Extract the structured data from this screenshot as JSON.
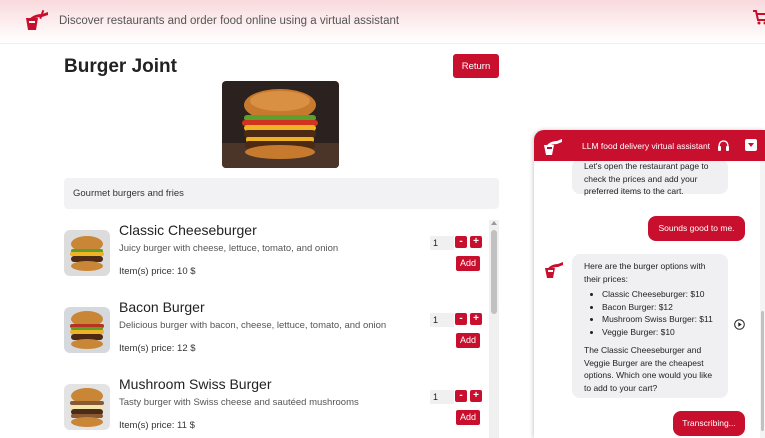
{
  "header": {
    "tagline": "Discover restaurants and order food online using a virtual assistant",
    "logo_icon": "food-delivery-logo-icon",
    "cart_icon": "cart-icon"
  },
  "restaurant": {
    "name": "Burger Joint",
    "return_label": "Return",
    "description": "Gourmet burgers and fries"
  },
  "menu": {
    "items": [
      {
        "name": "Classic Cheeseburger",
        "description": "Juicy burger with cheese, lettuce, tomato, and onion",
        "price": "Item(s) price: 10 $",
        "quantity": "1",
        "add_label": "Add",
        "minus_label": "-",
        "plus_label": "+"
      },
      {
        "name": "Bacon Burger",
        "description": "Delicious burger with bacon, cheese, lettuce, tomato, and onion",
        "price": "Item(s) price: 12 $",
        "quantity": "1",
        "add_label": "Add",
        "minus_label": "-",
        "plus_label": "+"
      },
      {
        "name": "Mushroom Swiss Burger",
        "description": "Tasty burger with Swiss cheese and sautéed mushrooms",
        "price": "Item(s) price: 11 $",
        "quantity": "1",
        "add_label": "Add",
        "minus_label": "-",
        "plus_label": "+"
      }
    ]
  },
  "chat": {
    "title": "LLM food delivery virtual assistant",
    "messages": {
      "bot_1": "Let's open the restaurant page to check the prices and add your preferred items to the cart.",
      "user_1": "Sounds good to me.",
      "bot_2_intro": "Here are the burger options with their prices:",
      "bot_2_list": [
        "Classic Cheeseburger: $10",
        "Bacon Burger: $12",
        "Mushroom Swiss Burger: $11",
        "Veggie Burger: $10"
      ],
      "bot_2_outro": "The Classic Cheeseburger and Veggie Burger are the cheapest options. Which one would you like to add to your cart?",
      "user_2": "Transcribing..."
    }
  },
  "colors": {
    "accent": "#c8102e",
    "bubble_bg": "#f0f0f2",
    "header_tint": "#f9d9dc"
  }
}
